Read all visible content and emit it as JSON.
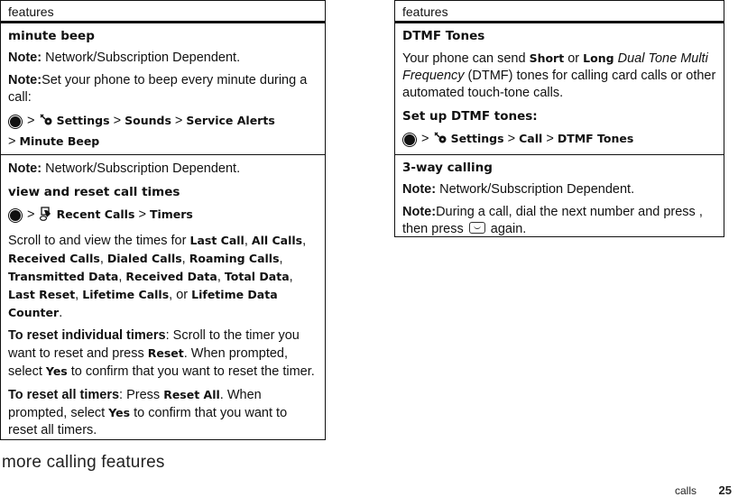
{
  "header_label": "features",
  "left": {
    "minute_beep": {
      "title": "minute beep",
      "note1_label": "Note:",
      "note1_text": " Network/Subscription Dependent.",
      "note2_label": "Note:",
      "note2_text": "Set your phone to beep every minute during a call:",
      "path": [
        "Settings",
        "Sounds",
        "Service Alerts",
        "Minute Beep"
      ],
      "separator": ">"
    },
    "call_times": {
      "note_label": "Note:",
      "note_text": " Network/Subscription Dependent.",
      "title": "view and reset call times",
      "path": [
        "Recent Calls",
        "Timers"
      ],
      "scroll_intro": "Scroll to and view the times for ",
      "timers": [
        "Last Call",
        "All Calls",
        "Received Calls",
        "Dialed Calls",
        "Roaming Calls",
        "Transmitted Data",
        "Received Data",
        "Total Data",
        "Last Reset",
        "Lifetime Calls",
        "Lifetime Data Counter"
      ],
      "or_word": "or",
      "reset_individual_label": "To reset individual timers",
      "reset_individual_text1": ": Scroll to the timer you want to reset and press ",
      "reset_key": "Reset",
      "reset_individual_text2": ". When prompted, select ",
      "yes_key": "Yes",
      "reset_individual_text3": " to confirm that you want to reset the timer.",
      "reset_all_label": "To reset all timers",
      "reset_all_text1": ": Press ",
      "reset_all_key": "Reset All",
      "reset_all_text2": ". When prompted, select ",
      "reset_all_text3": " to confirm that you want to reset all timers."
    }
  },
  "right": {
    "dtmf": {
      "title": "DTMF Tones",
      "text1": "Your phone can send ",
      "short_key": "Short",
      "or_word": " or ",
      "long_key": "Long",
      "italic_term": "Dual Tone Multi Frequency",
      "text2": " (DTMF) tones for calling card calls or other automated touch-tone calls.",
      "setup_title": "Set up DTMF tones:",
      "path": [
        "Settings",
        "Call",
        "DTMF Tones"
      ]
    },
    "three_way": {
      "title": "3-way calling",
      "note1_label": "Note:",
      "note1_text": " Network/Subscription Dependent.",
      "note2_label": "Note:",
      "note2_text1": "During a call, dial the next number and press , then press ",
      "note2_text2": " again."
    }
  },
  "page_title": "more calling features",
  "footer": {
    "section": "calls",
    "page": "25"
  }
}
